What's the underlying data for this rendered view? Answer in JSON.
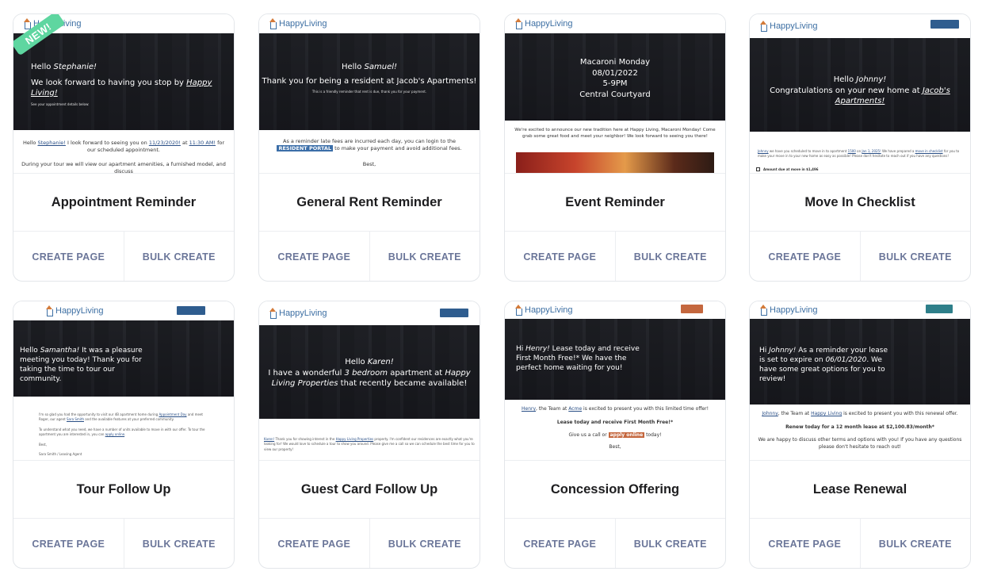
{
  "badge": {
    "new": "NEW!"
  },
  "actions": {
    "create": "CREATE PAGE",
    "bulk": "BULK CREATE"
  },
  "logo": {
    "text": "HappyLiving"
  },
  "colors": {
    "accent_blue": "#3b6ea8",
    "accent_orange": "#c4673e",
    "accent_teal": "#2e7f8a",
    "action_text": "#6b7699",
    "badge_green": "#5ed6a0"
  },
  "cards": [
    {
      "title": "Appointment Reminder",
      "hero": {
        "l1a": "Hello ",
        "l1b": "Stephanie!",
        "l2a": "We look forward to having you stop by ",
        "l2b": "Happy Living!",
        "small": "See your appointment details below:"
      },
      "body": {
        "p1a": "Hello ",
        "p1b": "Stephanie!",
        "p1c": " I look forward to seeing you on ",
        "p1d": "11/23/2020!",
        "p1e": " at ",
        "p1f": "11:30 AM!",
        "p1g": " for our scheduled appointment.",
        "p2": "During your tour we will view our apartment amenities, a furnished model, and discuss"
      }
    },
    {
      "title": "General Rent Reminder",
      "hero": {
        "l1a": "Hello ",
        "l1b": "Samuel!",
        "l2": "Thank you for being a resident at Jacob's Apartments!",
        "small": "This is a friendly reminder that rent is due, thank you for your payment."
      },
      "body": {
        "p1a": "As a reminder late fees are incurred each day, you can login to the ",
        "p1b": "RESIDENT PORTAL",
        "p1c": " to make your payment and avoid additional fees.",
        "p2": "Best,"
      }
    },
    {
      "title": "Event Reminder",
      "hero": {
        "l1": "Macaroni Monday",
        "l2": "08/01/2022",
        "l3": "5-9PM",
        "l4": "Central Courtyard"
      },
      "body": {
        "p1": "We're excited to announce our new tradition here at Happy Living, Macaroni Monday! Come grab some great food and meet your neighbor! We look forward to seeing you there!"
      }
    },
    {
      "title": "Move In Checklist",
      "hero": {
        "l1a": "Hello ",
        "l1b": "Johnny!",
        "l2a": "Congratulations on your new home at ",
        "l2b": "Jacob's Apartments!"
      },
      "body": {
        "p1a": "Johnny",
        "p1b": " we have you scheduled to move in to apartment ",
        "p1c": "1500",
        "p1d": " on ",
        "p1e": "Jan 1, 2025!",
        "p1f": " We have prepared a ",
        "p1g": "move in checklist",
        "p1h": " for you to make your move in to your new home as easy as possible! Please don't hesitate to reach out if you have any questions!",
        "check": "Amount due at move in $1,496"
      }
    },
    {
      "title": "Tour Follow Up",
      "hero": {
        "l1a": "Hello ",
        "l1b": "Samantha!",
        "l1c": " It was a pleasure meeting you today! Thank you for taking the time to tour our community."
      },
      "body": {
        "p1a": "I'm so glad you had the opportunity to visit our 4B apartment home during ",
        "p1b": "Appointment Day",
        "p1c": " and meet Roger, our agent ",
        "p1d": "Sara Smith",
        "p1e": " and the available features at your preferred community.",
        "p2a": "To understand what you need, we have a number of units available to move in with our offer. To tour the apartment you are interested in, you can ",
        "p2b": "apply online",
        "p2c": ".",
        "p3": "Best,",
        "p4": "Sara Smith / Leasing Agent"
      }
    },
    {
      "title": "Guest Card Follow Up",
      "hero": {
        "l1a": "Hello ",
        "l1b": "Karen!",
        "l2a": "I have a wonderful ",
        "l2b": "3 bedroom",
        "l2c": " apartment at ",
        "l2d": "Happy Living Properties",
        "l2e": " that recently became available!"
      },
      "body": {
        "p1a": "Karen!",
        "p1b": " Thank you for showing interest in the ",
        "p1c": "Happy Living Properties",
        "p1d": " property. I'm confident our residences are exactly what you're looking for! We would love to schedule a tour to show you around. Please give me a call so we can schedule the best time for you to view our property!"
      }
    },
    {
      "title": "Concession Offering",
      "hero": {
        "l1a": "Hi ",
        "l1b": "Henry!",
        "l1c": " Lease today and receive First Month Free!* We have the perfect home waiting for you!"
      },
      "body": {
        "p1a": "Henry",
        "p1b": ", the Team at ",
        "p1c": "Acme",
        "p1d": " is excited to present you with this limited time offer!",
        "p2": "Lease today and receive First Month Free!*",
        "p3a": "Give us a call or ",
        "p3b": "apply online",
        "p3c": " today!",
        "p4": "Best,"
      }
    },
    {
      "title": "Lease Renewal",
      "hero": {
        "l1a": "Hi ",
        "l1b": "Johnny!",
        "l1c": " As a reminder your lease is set to expire on ",
        "l1d": "06/01/2020",
        "l1e": ". We have some great options for you to review!"
      },
      "body": {
        "p1a": "Johnny",
        "p1b": ", the Team at ",
        "p1c": "Happy Living",
        "p1d": " is excited to present you with this renewal offer.",
        "p2": "Renew today for a 12 month lease at $2,100.83/month*",
        "p3": "We are happy to discuss other terms and options with you! If you have any questions please don't hesitate to reach out!"
      }
    }
  ]
}
